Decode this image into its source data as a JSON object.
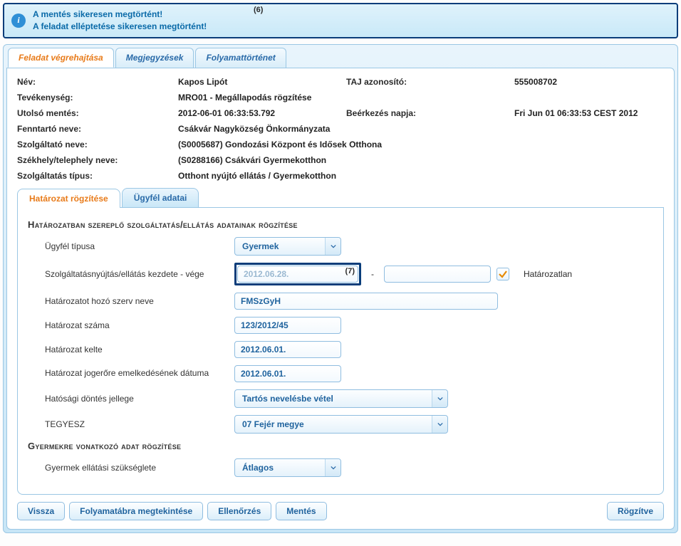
{
  "banner": {
    "line1": "A mentés sikeresen megtörtént!",
    "line2": "A feladat elléptetése sikeresen megtörtént!",
    "annotation": "(6)"
  },
  "tabs": {
    "t1": "Feladat végrehajtása",
    "t2": "Megjegyzések",
    "t3": "Folyamattörténet"
  },
  "info": {
    "name_lbl": "Név:",
    "name_val": "Kapos Lipót",
    "taj_lbl": "TAJ azonosító:",
    "taj_val": "555008702",
    "tev_lbl": "Tevékenység:",
    "tev_val": "MRO01 - Megállapodás rögzítése",
    "lastsave_lbl": "Utolsó mentés:",
    "lastsave_val": "2012-06-01 06:33:53.792",
    "arrive_lbl": "Beérkezés napja:",
    "arrive_val": "Fri Jun 01 06:33:53 CEST 2012",
    "fenn_lbl": "Fenntartó neve:",
    "fenn_val": "Csákvár Nagyközség Önkormányzata",
    "szolg_lbl": "Szolgáltató neve:",
    "szolg_val": "(S0005687) Gondozási Központ és Idősek Otthona",
    "szek_lbl": "Székhely/telephely neve:",
    "szek_val": "(S0288166) Csákvári Gyermekotthon",
    "tipus_lbl": "Szolgáltatás típus:",
    "tipus_val": "Otthont nyújtó ellátás / Gyermekotthon"
  },
  "subtabs": {
    "s1": "Határozat rögzítése",
    "s2": "Ügyfél adatai"
  },
  "section1_title": "Határozatban szereplő szolgáltatás/ellátás adatainak rögzítése",
  "form": {
    "ugyfel_lbl": "Ügyfél típusa",
    "ugyfel_val": "Gyermek",
    "kezdet_lbl": "Szolgáltatásnyújtás/ellátás kezdete - vége",
    "kezdet_val": "2012.06.28.",
    "kezdet_ann": "(7)",
    "dash": "-",
    "vege_val": "",
    "hatarozatlan_lbl": "Határozatlan",
    "szerv_lbl": "Határozatot hozó szerv neve",
    "szerv_val": "FMSzGyH",
    "szam_lbl": "Határozat száma",
    "szam_val": "123/2012/45",
    "kelte_lbl": "Határozat kelte",
    "kelte_val": "2012.06.01.",
    "jogero_lbl": "Határozat jogerőre emelkedésének dátuma",
    "jogero_val": "2012.06.01.",
    "dontes_lbl": "Hatósági döntés jellege",
    "dontes_val": "Tartós nevelésbe vétel",
    "tegyesz_lbl": "TEGYESZ",
    "tegyesz_val": "07 Fejér megye"
  },
  "section2_title": "Gyermekre vonatkozó adat rögzítése",
  "form2": {
    "szukseglet_lbl": "Gyermek ellátási szükséglete",
    "szukseglet_val": "Átlagos"
  },
  "buttons": {
    "vissza": "Vissza",
    "folyamatabra": "Folyamatábra megtekintése",
    "ellenorzes": "Ellenőrzés",
    "mentes": "Mentés",
    "rogzitve": "Rögzítve"
  }
}
